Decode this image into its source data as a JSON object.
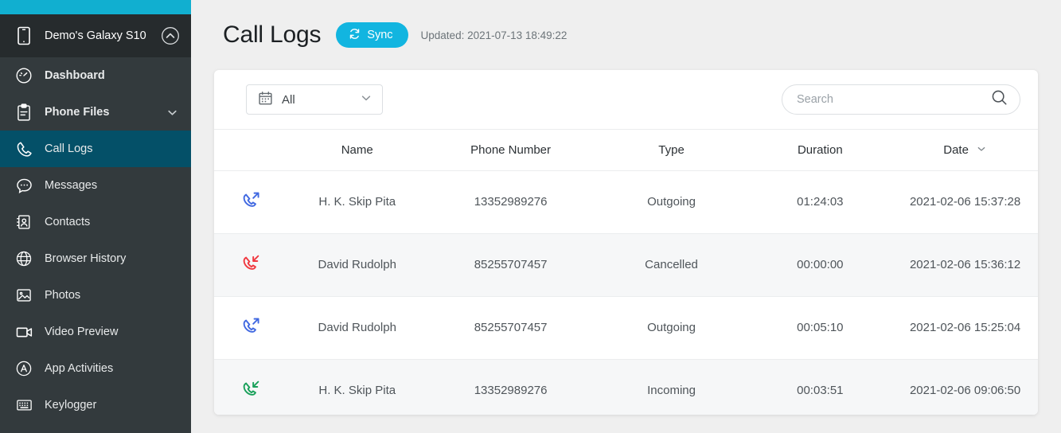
{
  "sidebar": {
    "device": {
      "name": "Demo's Galaxy S10",
      "icon": "phone-icon",
      "collapse_icon": "chevron-up-circle-icon"
    },
    "items": [
      {
        "label": "Dashboard",
        "icon": "dashboard-icon",
        "bold": true,
        "active": false,
        "chevron": false
      },
      {
        "label": "Phone Files",
        "icon": "clipboard-icon",
        "bold": true,
        "active": false,
        "chevron": true
      },
      {
        "label": "Call Logs",
        "icon": "phone-call-icon",
        "bold": false,
        "active": true,
        "chevron": false
      },
      {
        "label": "Messages",
        "icon": "message-bubble-icon",
        "bold": false,
        "active": false,
        "chevron": false
      },
      {
        "label": "Contacts",
        "icon": "contacts-icon",
        "bold": false,
        "active": false,
        "chevron": false
      },
      {
        "label": "Browser History",
        "icon": "globe-icon",
        "bold": false,
        "active": false,
        "chevron": false
      },
      {
        "label": "Photos",
        "icon": "photo-icon",
        "bold": false,
        "active": false,
        "chevron": false
      },
      {
        "label": "Video Preview",
        "icon": "video-camera-icon",
        "bold": false,
        "active": false,
        "chevron": false
      },
      {
        "label": "App Activities",
        "icon": "app-activities-icon",
        "bold": false,
        "active": false,
        "chevron": false
      },
      {
        "label": "Keylogger",
        "icon": "keyboard-icon",
        "bold": false,
        "active": false,
        "chevron": false
      }
    ]
  },
  "header": {
    "title": "Call Logs",
    "sync_label": "Sync",
    "sync_icon": "refresh-icon",
    "updated_text": "Updated: 2021-07-13 18:49:22"
  },
  "toolbar": {
    "filter_label": "All",
    "filter_icon": "calendar-icon",
    "filter_chevron": "chevron-down-icon",
    "search_placeholder": "Search",
    "search_value": "",
    "search_icon": "search-icon"
  },
  "table": {
    "columns": [
      "",
      "Name",
      "Phone Number",
      "Type",
      "Duration",
      "Date"
    ],
    "sort_column": "Date",
    "sort_icon": "chevron-down-icon",
    "rows": [
      {
        "icon": "call-outgoing-icon",
        "icon_color": "#4169e1",
        "name": "H. K. Skip Pita",
        "phone": "13352989276",
        "type": "Outgoing",
        "duration": "01:24:03",
        "date": "2021-02-06 15:37:28"
      },
      {
        "icon": "call-missed-icon",
        "icon_color": "#f0383f",
        "name": "David Rudolph",
        "phone": "85255707457",
        "type": "Cancelled",
        "duration": "00:00:00",
        "date": "2021-02-06 15:36:12"
      },
      {
        "icon": "call-outgoing-icon",
        "icon_color": "#4169e1",
        "name": "David Rudolph",
        "phone": "85255707457",
        "type": "Outgoing",
        "duration": "00:05:10",
        "date": "2021-02-06 15:25:04"
      },
      {
        "icon": "call-incoming-icon",
        "icon_color": "#19a05a",
        "name": "H. K. Skip Pita",
        "phone": "13352989276",
        "type": "Incoming",
        "duration": "00:03:51",
        "date": "2021-02-06 09:06:50"
      }
    ]
  },
  "colors": {
    "accent": "#11afd0",
    "sync": "#12b5e0",
    "sidebar": "#333a3d",
    "sidebar_header": "#262b2d",
    "active_item": "#045068",
    "page_bg": "#efefef"
  }
}
